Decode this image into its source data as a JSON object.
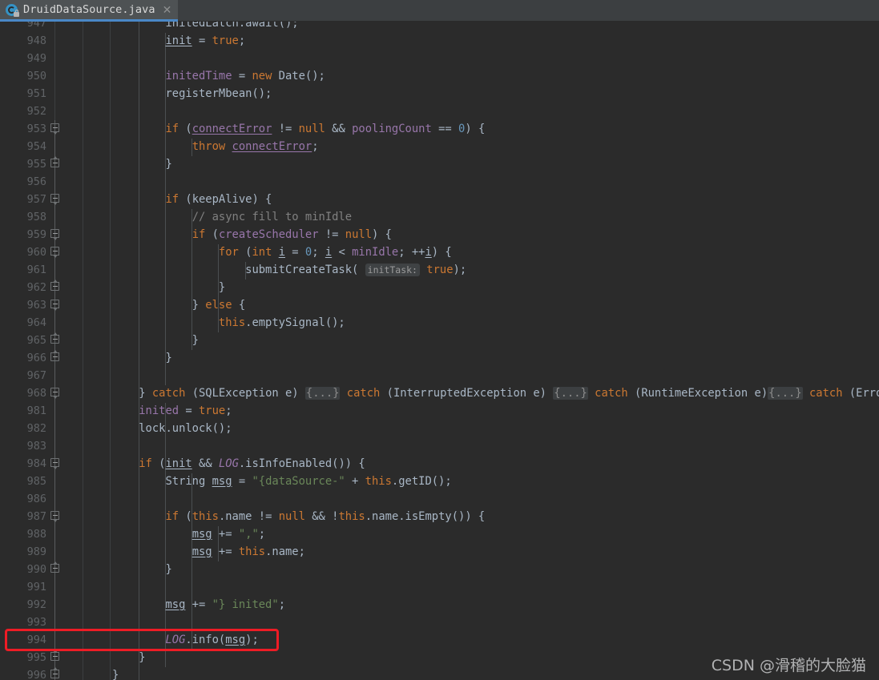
{
  "tab": {
    "filename": "DruidDataSource.java",
    "file_icon": "java-class-icon",
    "lock_icon": "lock-icon",
    "close_icon": "close-icon",
    "accent_color": "#4a88c7"
  },
  "editor": {
    "background": "#2b2b2b",
    "gutter_color": "#606366",
    "first_line": 947,
    "line_height": 22,
    "colors": {
      "keyword": "#cc7832",
      "field": "#9876aa",
      "number": "#6897bb",
      "string": "#6a8759",
      "comment": "#808080",
      "plain": "#a9b7c6",
      "folded": "#8a8a8a"
    },
    "lines": [
      {
        "n": 947,
        "indent": 0,
        "fold": "",
        "clipped": true,
        "tokens": [
          {
            "t": "        ",
            "c": "pln"
          },
          {
            "t": "initedLatch",
            "c": "pln"
          },
          {
            "t": ".",
            "c": "pln"
          },
          {
            "t": "await",
            "c": "pln"
          },
          {
            "t": "();",
            "c": "pln"
          }
        ]
      },
      {
        "n": 948,
        "indent": 0,
        "fold": "",
        "tokens": [
          {
            "t": "        ",
            "c": "pln"
          },
          {
            "t": "init",
            "c": "loc"
          },
          {
            "t": " = ",
            "c": "pln"
          },
          {
            "t": "true",
            "c": "kw"
          },
          {
            "t": ";",
            "c": "pln"
          }
        ]
      },
      {
        "n": 949,
        "indent": 0,
        "fold": "",
        "tokens": []
      },
      {
        "n": 950,
        "indent": 0,
        "fold": "",
        "tokens": [
          {
            "t": "        ",
            "c": "pln"
          },
          {
            "t": "initedTime",
            "c": "fld"
          },
          {
            "t": " = ",
            "c": "pln"
          },
          {
            "t": "new",
            "c": "kw"
          },
          {
            "t": " Date();",
            "c": "pln"
          }
        ]
      },
      {
        "n": 951,
        "indent": 0,
        "fold": "",
        "tokens": [
          {
            "t": "        ",
            "c": "pln"
          },
          {
            "t": "registerMbean();",
            "c": "pln"
          }
        ]
      },
      {
        "n": 952,
        "indent": 0,
        "fold": "",
        "tokens": []
      },
      {
        "n": 953,
        "indent": 0,
        "fold": "start",
        "tokens": [
          {
            "t": "        ",
            "c": "pln"
          },
          {
            "t": "if",
            "c": "kw"
          },
          {
            "t": " (",
            "c": "pln"
          },
          {
            "t": "connectError",
            "c": "fldu"
          },
          {
            "t": " != ",
            "c": "pln"
          },
          {
            "t": "null",
            "c": "kw"
          },
          {
            "t": " && ",
            "c": "pln"
          },
          {
            "t": "poolingCount",
            "c": "fld"
          },
          {
            "t": " == ",
            "c": "pln"
          },
          {
            "t": "0",
            "c": "num"
          },
          {
            "t": ") {",
            "c": "pln"
          }
        ]
      },
      {
        "n": 954,
        "indent": 0,
        "fold": "",
        "tokens": [
          {
            "t": "            ",
            "c": "pln"
          },
          {
            "t": "throw",
            "c": "kw"
          },
          {
            "t": " ",
            "c": "pln"
          },
          {
            "t": "connectError",
            "c": "fldu"
          },
          {
            "t": ";",
            "c": "pln"
          }
        ]
      },
      {
        "n": 955,
        "indent": 0,
        "fold": "end",
        "tokens": [
          {
            "t": "        }",
            "c": "pln"
          }
        ]
      },
      {
        "n": 956,
        "indent": 0,
        "fold": "",
        "tokens": []
      },
      {
        "n": 957,
        "indent": 0,
        "fold": "start",
        "tokens": [
          {
            "t": "        ",
            "c": "pln"
          },
          {
            "t": "if",
            "c": "kw"
          },
          {
            "t": " (keepAlive) {",
            "c": "pln"
          }
        ]
      },
      {
        "n": 958,
        "indent": 0,
        "fold": "",
        "tokens": [
          {
            "t": "            ",
            "c": "pln"
          },
          {
            "t": "// async fill to minIdle",
            "c": "cmt"
          }
        ]
      },
      {
        "n": 959,
        "indent": 0,
        "fold": "start",
        "tokens": [
          {
            "t": "            ",
            "c": "pln"
          },
          {
            "t": "if",
            "c": "kw"
          },
          {
            "t": " (",
            "c": "pln"
          },
          {
            "t": "createScheduler",
            "c": "fld"
          },
          {
            "t": " != ",
            "c": "pln"
          },
          {
            "t": "null",
            "c": "kw"
          },
          {
            "t": ") {",
            "c": "pln"
          }
        ]
      },
      {
        "n": 960,
        "indent": 0,
        "fold": "start",
        "tokens": [
          {
            "t": "                ",
            "c": "pln"
          },
          {
            "t": "for",
            "c": "kw"
          },
          {
            "t": " (",
            "c": "pln"
          },
          {
            "t": "int",
            "c": "kw"
          },
          {
            "t": " ",
            "c": "pln"
          },
          {
            "t": "i",
            "c": "loc"
          },
          {
            "t": " = ",
            "c": "pln"
          },
          {
            "t": "0",
            "c": "num"
          },
          {
            "t": "; ",
            "c": "pln"
          },
          {
            "t": "i",
            "c": "loc"
          },
          {
            "t": " < ",
            "c": "pln"
          },
          {
            "t": "minIdle",
            "c": "fld"
          },
          {
            "t": "; ++",
            "c": "pln"
          },
          {
            "t": "i",
            "c": "loc"
          },
          {
            "t": ") {",
            "c": "pln"
          }
        ]
      },
      {
        "n": 961,
        "indent": 0,
        "fold": "",
        "hint": "initTask:",
        "tokens": [
          {
            "t": "                    ",
            "c": "pln"
          },
          {
            "t": "submitCreateTask( ",
            "c": "pln"
          },
          {
            "t": "@HINT@",
            "c": "hint"
          },
          {
            "t": " ",
            "c": "pln"
          },
          {
            "t": "true",
            "c": "kw"
          },
          {
            "t": ");",
            "c": "pln"
          }
        ]
      },
      {
        "n": 962,
        "indent": 0,
        "fold": "end",
        "tokens": [
          {
            "t": "                }",
            "c": "pln"
          }
        ]
      },
      {
        "n": 963,
        "indent": 0,
        "fold": "start",
        "tokens": [
          {
            "t": "            } ",
            "c": "pln"
          },
          {
            "t": "else",
            "c": "kw"
          },
          {
            "t": " {",
            "c": "pln"
          }
        ]
      },
      {
        "n": 964,
        "indent": 0,
        "fold": "",
        "tokens": [
          {
            "t": "                ",
            "c": "pln"
          },
          {
            "t": "this",
            "c": "kw"
          },
          {
            "t": ".emptySignal();",
            "c": "pln"
          }
        ]
      },
      {
        "n": 965,
        "indent": 0,
        "fold": "end",
        "tokens": [
          {
            "t": "            }",
            "c": "pln"
          }
        ]
      },
      {
        "n": 966,
        "indent": 0,
        "fold": "end",
        "tokens": [
          {
            "t": "        }",
            "c": "pln"
          }
        ]
      },
      {
        "n": 967,
        "indent": 0,
        "fold": "",
        "tokens": []
      },
      {
        "n": 968,
        "indent": 0,
        "fold": "start",
        "tokens": [
          {
            "t": "    } ",
            "c": "pln"
          },
          {
            "t": "catch",
            "c": "kw"
          },
          {
            "t": " (SQLException e) ",
            "c": "pln"
          },
          {
            "t": "{...}",
            "c": "folded"
          },
          {
            "t": " ",
            "c": "pln"
          },
          {
            "t": "catch",
            "c": "kw"
          },
          {
            "t": " (InterruptedException e) ",
            "c": "pln"
          },
          {
            "t": "{...}",
            "c": "folded"
          },
          {
            "t": " ",
            "c": "pln"
          },
          {
            "t": "catch",
            "c": "kw"
          },
          {
            "t": " (RuntimeException e)",
            "c": "pln"
          },
          {
            "t": "{...}",
            "c": "folded"
          },
          {
            "t": " ",
            "c": "pln"
          },
          {
            "t": "catch",
            "c": "kw"
          },
          {
            "t": " (Error e)",
            "c": "pln"
          },
          {
            "t": "{...}",
            "c": "folded"
          }
        ]
      },
      {
        "n": 981,
        "indent": 0,
        "fold": "",
        "tokens": [
          {
            "t": "    ",
            "c": "pln"
          },
          {
            "t": "inited",
            "c": "fld"
          },
          {
            "t": " = ",
            "c": "pln"
          },
          {
            "t": "true",
            "c": "kw"
          },
          {
            "t": ";",
            "c": "pln"
          }
        ]
      },
      {
        "n": 982,
        "indent": 0,
        "fold": "",
        "tokens": [
          {
            "t": "    lock.unlock();",
            "c": "pln"
          }
        ]
      },
      {
        "n": 983,
        "indent": 0,
        "fold": "",
        "tokens": []
      },
      {
        "n": 984,
        "indent": 0,
        "fold": "start",
        "tokens": [
          {
            "t": "    ",
            "c": "pln"
          },
          {
            "t": "if",
            "c": "kw"
          },
          {
            "t": " (",
            "c": "pln"
          },
          {
            "t": "init",
            "c": "loc"
          },
          {
            "t": " && ",
            "c": "pln"
          },
          {
            "t": "LOG",
            "c": "fldi"
          },
          {
            "t": ".isInfoEnabled()) {",
            "c": "pln"
          }
        ]
      },
      {
        "n": 985,
        "indent": 0,
        "fold": "",
        "tokens": [
          {
            "t": "        String ",
            "c": "pln"
          },
          {
            "t": "msg",
            "c": "loc"
          },
          {
            "t": " = ",
            "c": "pln"
          },
          {
            "t": "\"{dataSource-\"",
            "c": "str"
          },
          {
            "t": " + ",
            "c": "pln"
          },
          {
            "t": "this",
            "c": "kw"
          },
          {
            "t": ".getID();",
            "c": "pln"
          }
        ]
      },
      {
        "n": 986,
        "indent": 0,
        "fold": "",
        "tokens": []
      },
      {
        "n": 987,
        "indent": 0,
        "fold": "start",
        "tokens": [
          {
            "t": "        ",
            "c": "pln"
          },
          {
            "t": "if",
            "c": "kw"
          },
          {
            "t": " (",
            "c": "pln"
          },
          {
            "t": "this",
            "c": "kw"
          },
          {
            "t": ".name != ",
            "c": "pln"
          },
          {
            "t": "null",
            "c": "kw"
          },
          {
            "t": " && !",
            "c": "pln"
          },
          {
            "t": "this",
            "c": "kw"
          },
          {
            "t": ".name.isEmpty()) {",
            "c": "pln"
          }
        ]
      },
      {
        "n": 988,
        "indent": 0,
        "fold": "",
        "tokens": [
          {
            "t": "            ",
            "c": "pln"
          },
          {
            "t": "msg",
            "c": "loc"
          },
          {
            "t": " += ",
            "c": "pln"
          },
          {
            "t": "\",\"",
            "c": "str"
          },
          {
            "t": ";",
            "c": "pln"
          }
        ]
      },
      {
        "n": 989,
        "indent": 0,
        "fold": "",
        "tokens": [
          {
            "t": "            ",
            "c": "pln"
          },
          {
            "t": "msg",
            "c": "loc"
          },
          {
            "t": " += ",
            "c": "pln"
          },
          {
            "t": "this",
            "c": "kw"
          },
          {
            "t": ".name;",
            "c": "pln"
          }
        ]
      },
      {
        "n": 990,
        "indent": 0,
        "fold": "end",
        "tokens": [
          {
            "t": "        }",
            "c": "pln"
          }
        ]
      },
      {
        "n": 991,
        "indent": 0,
        "fold": "",
        "tokens": []
      },
      {
        "n": 992,
        "indent": 0,
        "fold": "",
        "tokens": [
          {
            "t": "        ",
            "c": "pln"
          },
          {
            "t": "msg",
            "c": "loc"
          },
          {
            "t": " += ",
            "c": "pln"
          },
          {
            "t": "\"} inited\"",
            "c": "str"
          },
          {
            "t": ";",
            "c": "pln"
          }
        ]
      },
      {
        "n": 993,
        "indent": 0,
        "fold": "",
        "tokens": []
      },
      {
        "n": 994,
        "indent": 0,
        "fold": "",
        "highlighted": true,
        "tokens": [
          {
            "t": "        ",
            "c": "pln"
          },
          {
            "t": "LOG",
            "c": "fldi"
          },
          {
            "t": ".info(",
            "c": "pln"
          },
          {
            "t": "msg",
            "c": "loc"
          },
          {
            "t": ");",
            "c": "pln"
          }
        ]
      },
      {
        "n": 995,
        "indent": 0,
        "fold": "end",
        "tokens": [
          {
            "t": "    }",
            "c": "pln"
          }
        ]
      },
      {
        "n": 996,
        "indent": 0,
        "fold": "end",
        "tokens": [
          {
            "t": "}",
            "c": "pln"
          }
        ]
      }
    ]
  },
  "annotation": {
    "type": "red-rectangle-highlight",
    "color": "#ee1c25",
    "target_line": 994
  },
  "watermark": {
    "text": "CSDN @滑稽的大脸猫"
  }
}
